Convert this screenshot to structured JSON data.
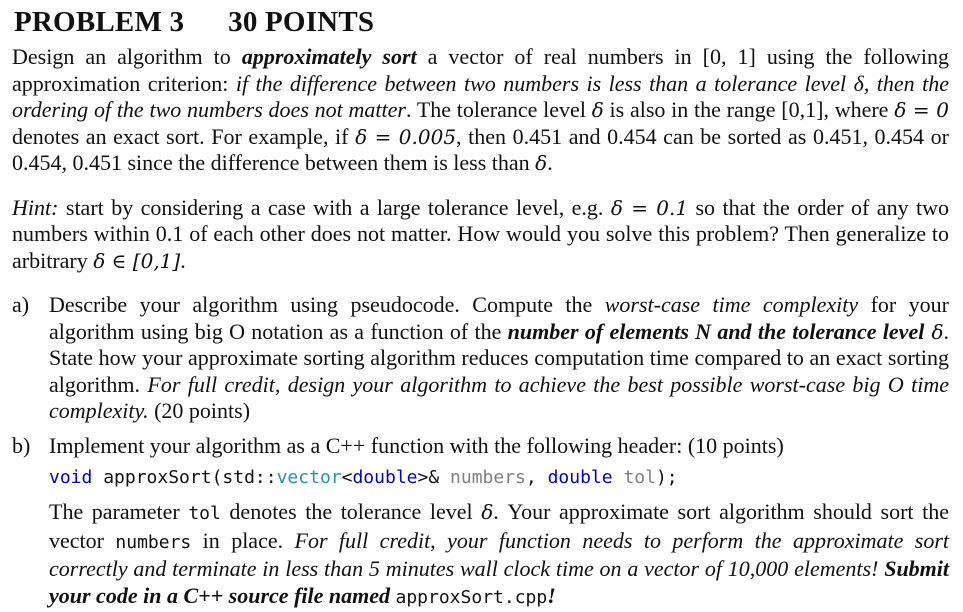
{
  "header": {
    "problem_label": "PROBLEM 3",
    "points_label": "30 POINTS"
  },
  "intro": {
    "t1": "Design an algorithm to ",
    "t2_bold_italic": "approximately sort",
    "t3": " a vector of real numbers in [0, 1] using the following approximation criterion: ",
    "t4_italic": "if the difference between two numbers is less than a tolerance level δ, then the ordering of the two numbers does not matter",
    "t5": ". The tolerance level ",
    "t6_math": "δ",
    "t7": " is also in the range [0,1], where ",
    "t8_math": "δ = 0",
    "t9": " denotes an exact sort. For example, if ",
    "t10_math": "δ  =  0.005",
    "t11": ", then 0.451 and 0.454 can be sorted as 0.451, 0.454 or 0.454, 0.451 since the difference between them is less than ",
    "t12_math": "δ",
    "t13": "."
  },
  "hint": {
    "label": "Hint:",
    "t1": " start by considering a case with a large tolerance level, e.g. ",
    "t2_math": "δ = 0.1",
    "t3": " so that the order of any two numbers within 0.1 of each other does not matter. How would you solve this problem? Then generalize to arbitrary ",
    "t4_math": "δ ∈ [0,1]",
    "t5": "."
  },
  "part_a": {
    "label": "a)",
    "t1": "Describe your algorithm using pseudocode. Compute the ",
    "t2_italic": "worst-case time complexity",
    "t3": " for your algorithm using big O notation as a function of the ",
    "t4_bold_italic": "number of elements N and the tolerance level",
    "t5_math": " δ",
    "t6": ". State how your approximate sorting algorithm reduces computation time compared to an exact sorting algorithm. ",
    "t7_italic": "For full credit, design your algorithm to achieve the best possible worst-case big O time complexity.",
    "t8": " (20 points)"
  },
  "part_b": {
    "label": "b)",
    "t1": "Implement your algorithm as a C++ function with the following header: (10 points)",
    "code": {
      "kw_void": "void",
      "fn_name": " approxSort(std::",
      "type_vector": "vector",
      "lt": "<",
      "kw_double1": "double",
      "gt_amp": ">& ",
      "param_numbers": "numbers",
      "comma": ", ",
      "kw_double2": "double",
      "space": " ",
      "param_tol": "tol",
      "end": ");"
    },
    "p1": "The parameter ",
    "p2_mono": "tol",
    "p3": " denotes the tolerance level ",
    "p4_math": "δ",
    "p5": ". Your approximate sort algorithm should sort the vector ",
    "p6_mono": "numbers",
    "p7": " in place. ",
    "p8_italic": "For full credit, your function needs to perform the approximate sort correctly and terminate in less than 5 minutes wall clock time on a vector of 10,000 elements!",
    "p9_space": " ",
    "p10_bold_italic": "Submit your code in a C++ source file named",
    "p11_space": " ",
    "p12_mono": "approxSort.cpp",
    "p13_bold_italic": "!"
  },
  "colors": {
    "keyword": "#0000c8",
    "type": "#2b91af",
    "parameter": "#808080",
    "text": "#111111"
  }
}
